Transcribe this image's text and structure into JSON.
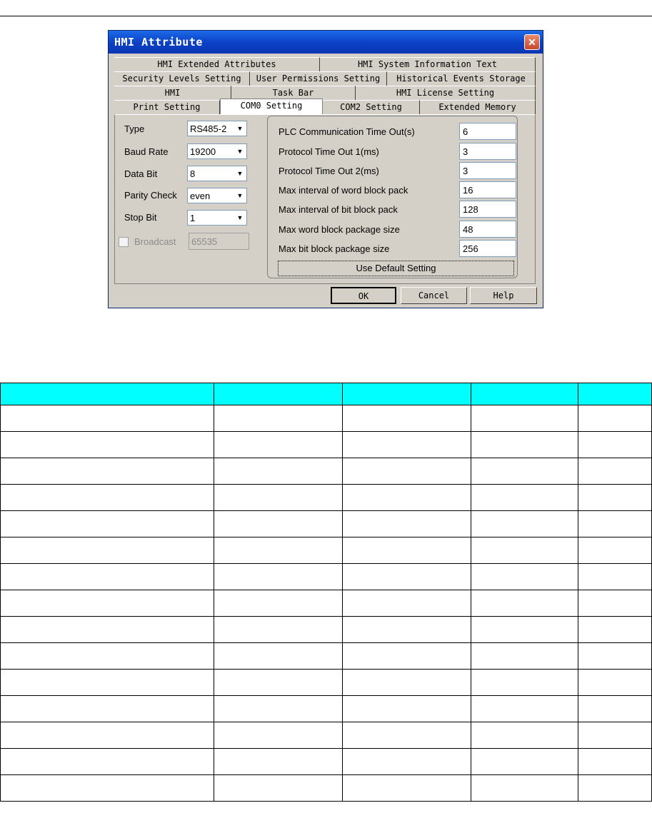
{
  "dialog": {
    "title": "HMI Attribute",
    "tabs_row1": [
      "HMI Extended Attributes",
      "HMI System Information Text"
    ],
    "tabs_row2": [
      "Security Levels Setting",
      "User Permissions Setting",
      "Historical Events Storage"
    ],
    "tabs_row3": [
      "HMI",
      "Task Bar",
      "HMI License Setting"
    ],
    "tabs_row4": [
      "Print Setting",
      "COM0 Setting",
      "COM2 Setting",
      "Extended Memory"
    ],
    "fields": {
      "type": {
        "label": "Type",
        "value": "RS485-2"
      },
      "baud_rate": {
        "label": "Baud Rate",
        "value": "19200"
      },
      "data_bit": {
        "label": "Data Bit",
        "value": "8"
      },
      "parity": {
        "label": "Parity Check",
        "value": "even"
      },
      "stop_bit": {
        "label": "Stop Bit",
        "value": "1"
      },
      "broadcast": {
        "label": "Broadcast",
        "value": "65535"
      }
    },
    "params": [
      {
        "label": "PLC Communication Time Out(s)",
        "value": "6"
      },
      {
        "label": "Protocol Time Out 1(ms)",
        "value": "3"
      },
      {
        "label": "Protocol Time Out 2(ms)",
        "value": "3"
      },
      {
        "label": "Max interval of word block pack",
        "value": "16"
      },
      {
        "label": "Max interval of bit block pack",
        "value": "128"
      },
      {
        "label": "Max word block package size",
        "value": "48"
      },
      {
        "label": "Max bit block package size",
        "value": "256"
      }
    ],
    "default_button": "Use Default Setting",
    "ok": "OK",
    "cancel": "Cancel",
    "help": "Help"
  }
}
